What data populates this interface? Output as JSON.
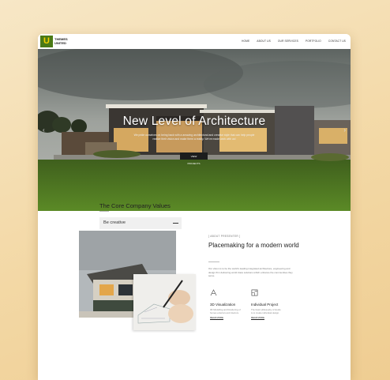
{
  "header": {
    "logo_letter": "U",
    "brand_line1": "THEMES",
    "brand_line2": "UNITED",
    "nav": [
      "HOME",
      "ABOUT US",
      "OUR SERVICES",
      "PORTFOLIO",
      "CONTACT US"
    ]
  },
  "hero": {
    "title": "New Level of Architecture",
    "subtitle": "We pride ourselves on being back with a amazing architectural and creative style that can help people realize their vision and make them a reality. We've made work with us!",
    "button_label": "VIEW PROJECTS"
  },
  "about": {
    "eyebrow": "[ ABOUT PRESENTER ]",
    "title": "Placemaking for a modern world",
    "paragraph": "Our vision is to be the world's leading integrated architecture, engineering and design firm delivering world class solutions which enhance the communities they serve.",
    "features": [
      {
        "icon": "compass-drawing-icon",
        "title": "3D Visualization",
        "desc": "3D Modelling and Rendering of homes exteriors and interiors.",
        "more": "READ MORE"
      },
      {
        "icon": "blueprint-icon",
        "title": "Individual Project",
        "desc": "The basic philosophy of studio is to create individual design.",
        "more": "READ MORE"
      }
    ]
  },
  "values": {
    "title": "The Core Company Values",
    "accordion_item": "Be creative"
  },
  "colors": {
    "logo_bg": "#4b7a16",
    "logo_fg": "#f5d000",
    "button_bg": "#1d1d1d"
  }
}
